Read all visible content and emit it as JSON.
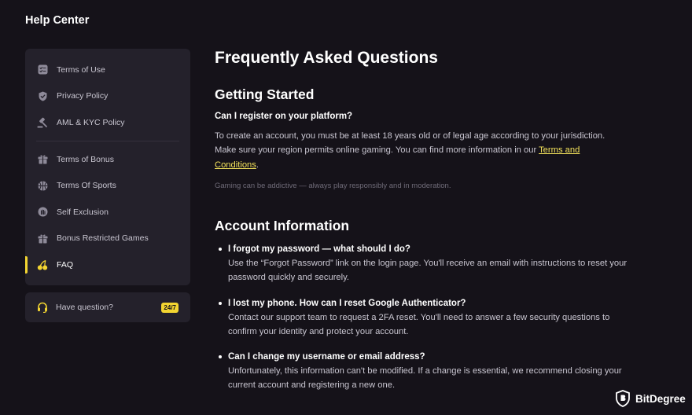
{
  "header": {
    "title": "Help Center"
  },
  "sidebar": {
    "group1": [
      {
        "label": "Terms of Use",
        "icon": "document-list-icon"
      },
      {
        "label": "Privacy Policy",
        "icon": "shield-check-icon"
      },
      {
        "label": "AML & KYC Policy",
        "icon": "gavel-icon"
      }
    ],
    "group2": [
      {
        "label": "Terms of Bonus",
        "icon": "gift-icon"
      },
      {
        "label": "Terms Of Sports",
        "icon": "basketball-icon"
      },
      {
        "label": "Self Exclusion",
        "icon": "hand-stop-icon"
      },
      {
        "label": "Bonus Restricted Games",
        "icon": "gift-icon"
      },
      {
        "label": "FAQ",
        "icon": "cherries-icon",
        "active": true
      }
    ]
  },
  "help": {
    "label": "Have question?",
    "badge": "24/7",
    "icon": "headset-icon"
  },
  "main": {
    "title": "Frequently Asked Questions",
    "section1": {
      "heading": "Getting Started",
      "question": "Can I register on your platform?",
      "answer_before": "To create an account, you must be at least 18 years old or of legal age according to your jurisdiction. Make sure your region permits online gaming. You can find more information in our ",
      "answer_link": "Terms and Conditions",
      "answer_after": ".",
      "note": "Gaming can be addictive — always play responsibly and in moderation."
    },
    "section2": {
      "heading": "Account Information",
      "items": [
        {
          "q": "I forgot my password — what should I do?",
          "a": "Use the “Forgot Password” link on the login page. You'll receive an email with instructions to reset your password quickly and securely."
        },
        {
          "q": "I lost my phone. How can I reset Google Authenticator?",
          "a": "Contact our support team to request a 2FA reset. You'll need to answer a few security questions to confirm your identity and protect your account."
        },
        {
          "q": "Can I change my username or email address?",
          "a": "Unfortunately, this information can't be modified. If a change is essential, we recommend closing your current account and registering a new one."
        }
      ]
    }
  },
  "watermark": {
    "text": "BitDegree"
  },
  "colors": {
    "background": "#151219",
    "panel": "#24212b",
    "accent": "#f3d531",
    "link": "#f3e25b"
  }
}
